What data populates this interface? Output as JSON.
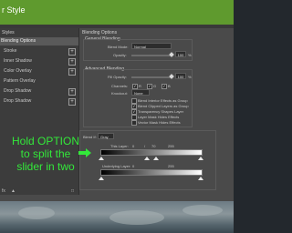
{
  "window": {
    "title": "r Style"
  },
  "styles_panel": {
    "header": "Styles",
    "items": [
      {
        "label": "Blending Options",
        "active": true,
        "has_plus": false
      },
      {
        "label": "Stroke",
        "active": false,
        "has_plus": true
      },
      {
        "label": "Inner Shadow",
        "active": false,
        "has_plus": true
      },
      {
        "label": "Color Overlay",
        "active": false,
        "has_plus": true
      },
      {
        "label": "Pattern Overlay",
        "active": false,
        "has_plus": false
      },
      {
        "label": "Drop Shadow",
        "active": false,
        "has_plus": true
      },
      {
        "label": "Drop Shadow",
        "active": false,
        "has_plus": true
      }
    ],
    "bottom_icons": [
      "fx-icon",
      "up-arrow-icon",
      "trash-icon"
    ]
  },
  "blending": {
    "section_title": "Blending Options",
    "general_title": "General Blending",
    "blend_mode_label": "Blend Mode:",
    "blend_mode_value": "Normal",
    "opacity_label": "Opacity:",
    "opacity_value": "100",
    "opacity_unit": "%",
    "opacity_level": 1.0
  },
  "advanced": {
    "title": "Advanced Blending",
    "fill_opacity_label": "Fill Opacity:",
    "fill_opacity_value": "100",
    "fill_opacity_unit": "%",
    "channels_label": "Channels:",
    "channels": [
      "R",
      "G",
      "B"
    ],
    "knockout_label": "Knockout:",
    "knockout_value": "None",
    "options": [
      {
        "label": "Blend Interior Effects as Group",
        "checked": false
      },
      {
        "label": "Blend Clipped Layers as Group",
        "checked": true
      },
      {
        "label": "Transparency Shapes Layer",
        "checked": true
      },
      {
        "label": "Layer Mask Hides Effects",
        "checked": false
      },
      {
        "label": "Vector Mask Hides Effects",
        "checked": false
      }
    ]
  },
  "blend_if": {
    "label": "Blend If:",
    "channel_value": "Gray",
    "this_layer_label": "This Layer:",
    "this_layer_values": [
      "0",
      "/",
      "70",
      "255"
    ],
    "underlying_label": "Underlying Layer:",
    "underlying_values": [
      "0",
      "",
      "",
      "255"
    ]
  },
  "annotation": {
    "text": "Hold OPTION to split the slider in two",
    "color": "#33e83a"
  },
  "colors": {
    "titlebar": "#5f9a2e",
    "dialog": "#4a4a4a",
    "panel": "#3c3c3c"
  }
}
